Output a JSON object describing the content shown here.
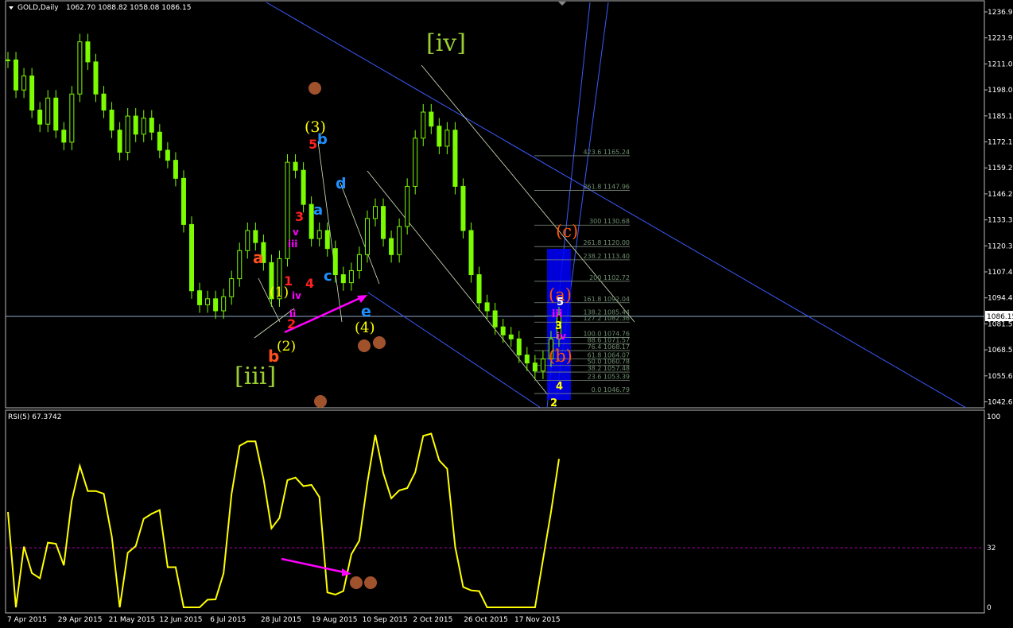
{
  "header": {
    "symbol": "GOLD,Daily",
    "ohlc": "1062.70 1088.82 1058.08 1086.15"
  },
  "price_axis": [
    "1236.90",
    "1223.95",
    "1211.00",
    "1198.05",
    "1185.10",
    "1172.15",
    "1159.20",
    "1146.25",
    "1133.30",
    "1120.35",
    "1107.40",
    "1094.45",
    "1081.50",
    "1068.55",
    "1055.60",
    "1042.65"
  ],
  "current_price": "1086.15",
  "rsi": {
    "label": "RSI(5) 67.3742",
    "axis": [
      "100",
      "32",
      "0"
    ]
  },
  "date_axis": [
    "7 Apr 2015",
    "29 Apr 2015",
    "21 May 2015",
    "12 Jun 2015",
    "6 Jul 2015",
    "28 Jul 2015",
    "19 Aug 2015",
    "10 Sep 2015",
    "2 Oct 2015",
    "26 Oct 2015",
    "17 Nov 2015"
  ],
  "fib_levels": [
    {
      "label": "423.6 1165.24"
    },
    {
      "label": "361.8 1147.96"
    },
    {
      "label": "300 1130.68"
    },
    {
      "label": "261.8 1120.00"
    },
    {
      "label": "238.2 1113.40"
    },
    {
      "label": "200 1102.72"
    },
    {
      "label": "161.8 1092.04"
    },
    {
      "label": "138.2 1085.44"
    },
    {
      "label": "127.2 1082.36"
    },
    {
      "label": "100.0 1074.76"
    },
    {
      "label": "88.6 1071.57"
    },
    {
      "label": "76.4 1068.17"
    },
    {
      "label": "61.8 1064.07"
    },
    {
      "label": "50.0 1060.78"
    },
    {
      "label": "38.2 1057.48"
    },
    {
      "label": "23.6 1053.39"
    },
    {
      "label": "0.0 1046.79"
    }
  ],
  "wave_labels": [
    "[iv]",
    "[iii]",
    "(3)",
    "(1)",
    "(2)",
    "(4)",
    "(a)",
    "(b)",
    "(c)",
    "a",
    "b",
    "c",
    "d",
    "e",
    "1",
    "2",
    "3",
    "4",
    "5",
    "iii",
    "iv",
    "v",
    "ii"
  ],
  "colors": {
    "candle": "#7CFC00",
    "rsi_line": "#FFFF00",
    "channel": "#3B5BFF",
    "arrow": "#FF00FF",
    "marker": "#A0522D",
    "fib_box": "#0000FF"
  },
  "chart_data": {
    "type": "line",
    "series": [
      {
        "values": [
          1213,
          1198,
          1205,
          1188,
          1181,
          1194,
          1178,
          1172,
          1196,
          1222,
          1212,
          1196,
          1188,
          1178,
          1167,
          1185,
          1176,
          1184,
          1177,
          1168,
          1163,
          1154,
          1131,
          1098,
          1091,
          1094,
          1088,
          1095,
          1104,
          1118,
          1128,
          1122,
          1112,
          1094,
          1114,
          1162,
          1158,
          1141,
          1124,
          1128,
          1119,
          1106,
          1102,
          1108,
          1116,
          1134,
          1140,
          1124,
          1116,
          1130,
          1150,
          1174,
          1187,
          1180,
          1170,
          1178,
          1150,
          1128,
          1106,
          1092,
          1088,
          1080,
          1076,
          1074,
          1066,
          1062,
          1058,
          1064,
          1074,
          1086
        ]
      }
    ]
  }
}
